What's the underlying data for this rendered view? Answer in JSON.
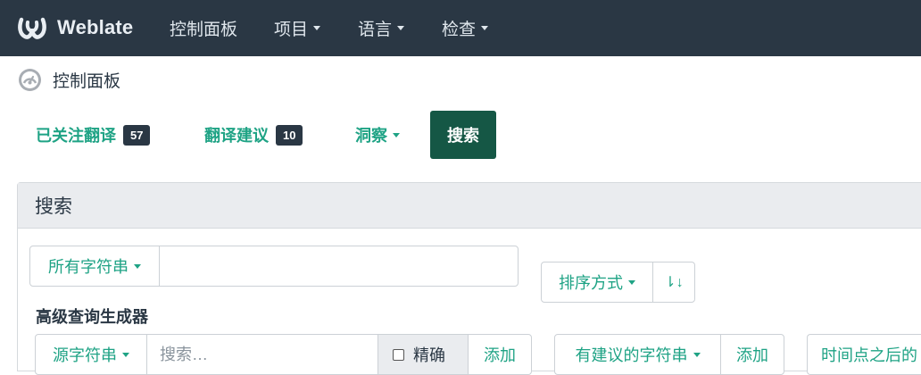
{
  "brand": {
    "name": "Weblate"
  },
  "nav": {
    "dashboard": "控制面板",
    "projects": "项目",
    "languages": "语言",
    "checks": "检查"
  },
  "breadcrumb": {
    "label": "控制面板"
  },
  "pills": {
    "watched": {
      "label": "已关注翻译",
      "count": "57"
    },
    "suggested": {
      "label": "翻译建议",
      "count": "10"
    },
    "insights": {
      "label": "洞察"
    },
    "search": {
      "label": "搜索"
    }
  },
  "panel": {
    "title": "搜索",
    "string_filter": "所有字符串",
    "query_value": "",
    "sort_by": "排序方式",
    "sort_direction_icon": "⇂↓"
  },
  "builder": {
    "title": "高级查询生成器",
    "field_select": "源字符串",
    "search_placeholder": "搜索…",
    "exact_label": "精确",
    "add_label": "添加",
    "suggestion_select": "有建议的字符串",
    "suggestion_add_label": "添加",
    "time_select": "时间点之后的"
  },
  "colors": {
    "navbar": "#2a3744",
    "accent": "#1fa385",
    "active_pill": "#155745"
  }
}
